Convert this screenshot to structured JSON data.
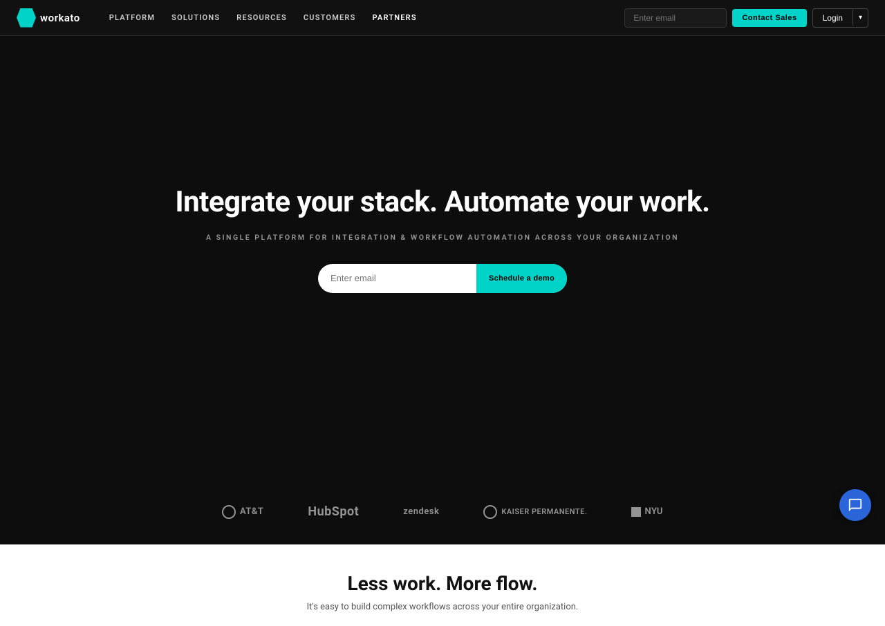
{
  "nav": {
    "logo_text": "workato",
    "links": [
      {
        "label": "PLATFORM",
        "key": "platform"
      },
      {
        "label": "SOLUTIONS",
        "key": "solutions"
      },
      {
        "label": "RESOURCES",
        "key": "resources"
      },
      {
        "label": "CUSTOMERS",
        "key": "customers"
      },
      {
        "label": "PARTNERS",
        "key": "partners"
      }
    ],
    "email_placeholder": "Enter email",
    "contact_btn": "Contact Sales",
    "login_btn": "Login"
  },
  "hero": {
    "title": "Integrate your stack. Automate your work.",
    "subtitle": "A SINGLE PLATFORM FOR INTEGRATION & WORKFLOW AUTOMATION ACROSS YOUR ORGANIZATION",
    "email_placeholder": "Enter email",
    "demo_btn": "Schedule a demo"
  },
  "logos": [
    {
      "name": "AT&T",
      "display": "⊕ AT&T",
      "key": "att"
    },
    {
      "name": "HubSpot",
      "display": "HubSpot",
      "key": "hubspot"
    },
    {
      "name": "Zendesk",
      "display": "zendesk",
      "key": "zendesk"
    },
    {
      "name": "Kaiser Permanente",
      "display": "⊕ KAISER PERMANENTE.",
      "key": "kaiser"
    },
    {
      "name": "NYU",
      "display": "■ NYU",
      "key": "nyu"
    }
  ],
  "bottom": {
    "title": "Less work. More flow.",
    "subtitle": "It's easy to build complex workflows across your entire organization."
  },
  "chat": {
    "label": "chat-support"
  }
}
